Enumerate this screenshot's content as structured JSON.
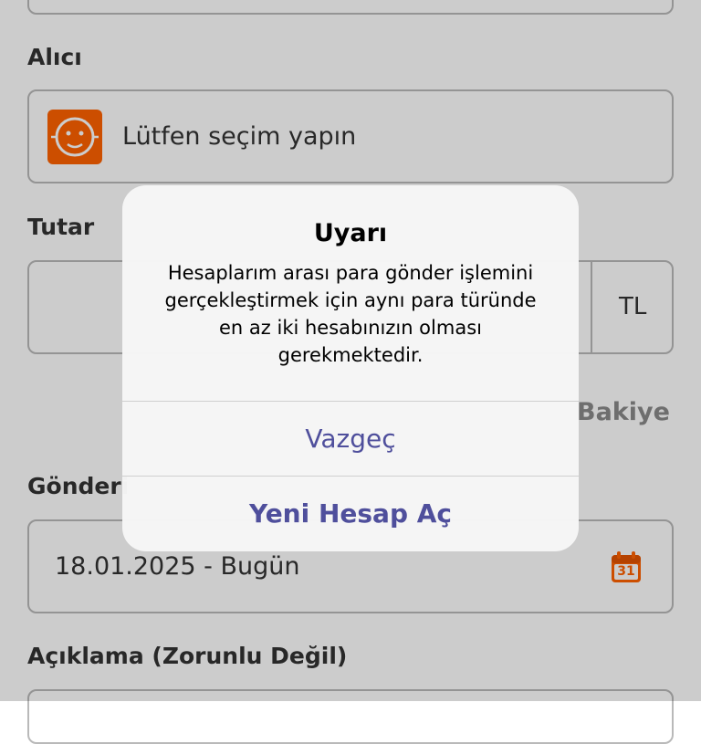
{
  "form": {
    "recipient_label": "Alıcı",
    "recipient_placeholder": "Lütfen seçim yapın",
    "amount_label": "Tutar",
    "currency": "TL",
    "balance_link": "Bakiye",
    "send_date_label": "Gönderi",
    "send_date_value": "18.01.2025 - Bugün",
    "calendar_day": "31",
    "description_label": "Açıklama (Zorunlu Değil)"
  },
  "alert": {
    "title": "Uyarı",
    "message_lines": [
      "Hesaplarım arası para gönder işlemini",
      "gerçekleştirmek için aynı para türünde",
      "en az iki hesabınızın olması",
      "gerekmektedir."
    ],
    "cancel_label": "Vazgeç",
    "primary_label": "Yeni Hesap Aç"
  },
  "colors": {
    "brand_orange": "#ff6200",
    "button_text": "#4f4f9c",
    "dim_overlay": "rgba(0,0,0,0.20)"
  },
  "icons": {
    "logo": "lion-logo-icon",
    "calendar": "calendar-icon"
  }
}
